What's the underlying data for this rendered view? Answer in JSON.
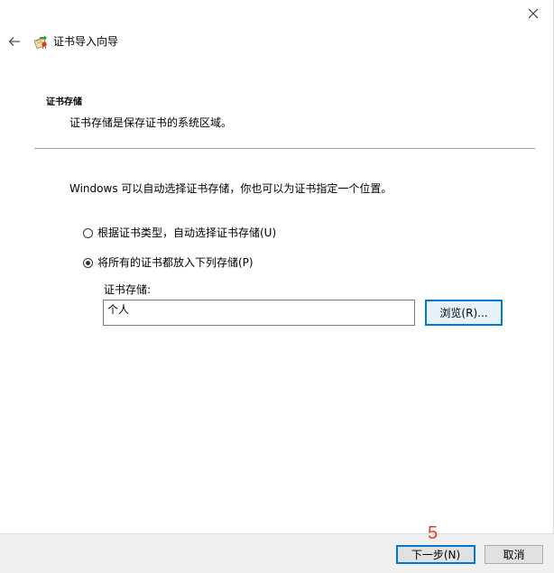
{
  "window": {
    "title": "证书导入向导"
  },
  "section": {
    "title": "证书存储",
    "description": "证书存储是保存证书的系统区域。"
  },
  "intro_text": "Windows 可以自动选择证书存储，你也可以为证书指定一个位置。",
  "options": [
    {
      "label": "根据证书类型，自动选择证书存储(U)",
      "checked": false
    },
    {
      "label": "将所有的证书都放入下列存储(P)",
      "checked": true
    }
  ],
  "store": {
    "label": "证书存储:",
    "value": "个人",
    "browse_label": "浏览(R)..."
  },
  "footer": {
    "next_label": "下一步(N)",
    "cancel_label": "取消"
  },
  "annotation": {
    "step_number": "5",
    "color": "#e8382c"
  },
  "colors": {
    "accent": "#0078d7",
    "footer_bg": "#f0f0f0"
  },
  "icons": {
    "close": "close-icon",
    "back": "back-arrow-icon",
    "cert": "certificate-icon"
  }
}
